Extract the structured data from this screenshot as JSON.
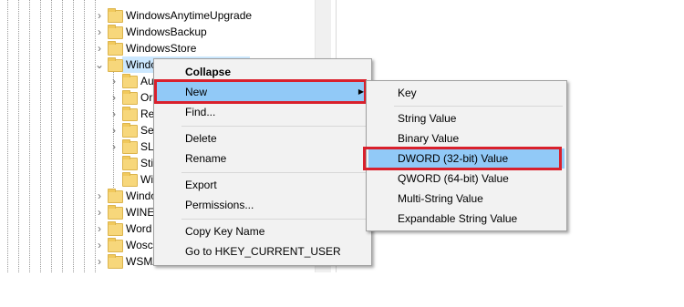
{
  "tree": {
    "nodes": [
      {
        "label": "WindowsAnytimeUpgrade"
      },
      {
        "label": "WindowsBackup"
      },
      {
        "label": "WindowsStore"
      },
      {
        "label": "Windo"
      },
      {
        "label": "Au"
      },
      {
        "label": "Or"
      },
      {
        "label": "Re"
      },
      {
        "label": "Se"
      },
      {
        "label": "SLS"
      },
      {
        "label": "Sti"
      },
      {
        "label": "Wi"
      },
      {
        "label": "Windo"
      },
      {
        "label": "WINE"
      },
      {
        "label": "Word"
      },
      {
        "label": "Wosc"
      },
      {
        "label": "WSMA"
      }
    ]
  },
  "context_menu": {
    "items": [
      {
        "label": "Collapse"
      },
      {
        "label": "New"
      },
      {
        "label": "Find..."
      },
      {
        "label": "Delete"
      },
      {
        "label": "Rename"
      },
      {
        "label": "Export"
      },
      {
        "label": "Permissions..."
      },
      {
        "label": "Copy Key Name"
      },
      {
        "label": "Go to HKEY_CURRENT_USER"
      }
    ]
  },
  "submenu": {
    "items": [
      {
        "label": "Key"
      },
      {
        "label": "String Value"
      },
      {
        "label": "Binary Value"
      },
      {
        "label": "DWORD (32-bit) Value"
      },
      {
        "label": "QWORD (64-bit) Value"
      },
      {
        "label": "Multi-String Value"
      },
      {
        "label": "Expandable String Value"
      }
    ]
  },
  "colors": {
    "highlight": "#91c9f7",
    "annotation_box": "#d9202c",
    "folder": "#f7d77b"
  }
}
